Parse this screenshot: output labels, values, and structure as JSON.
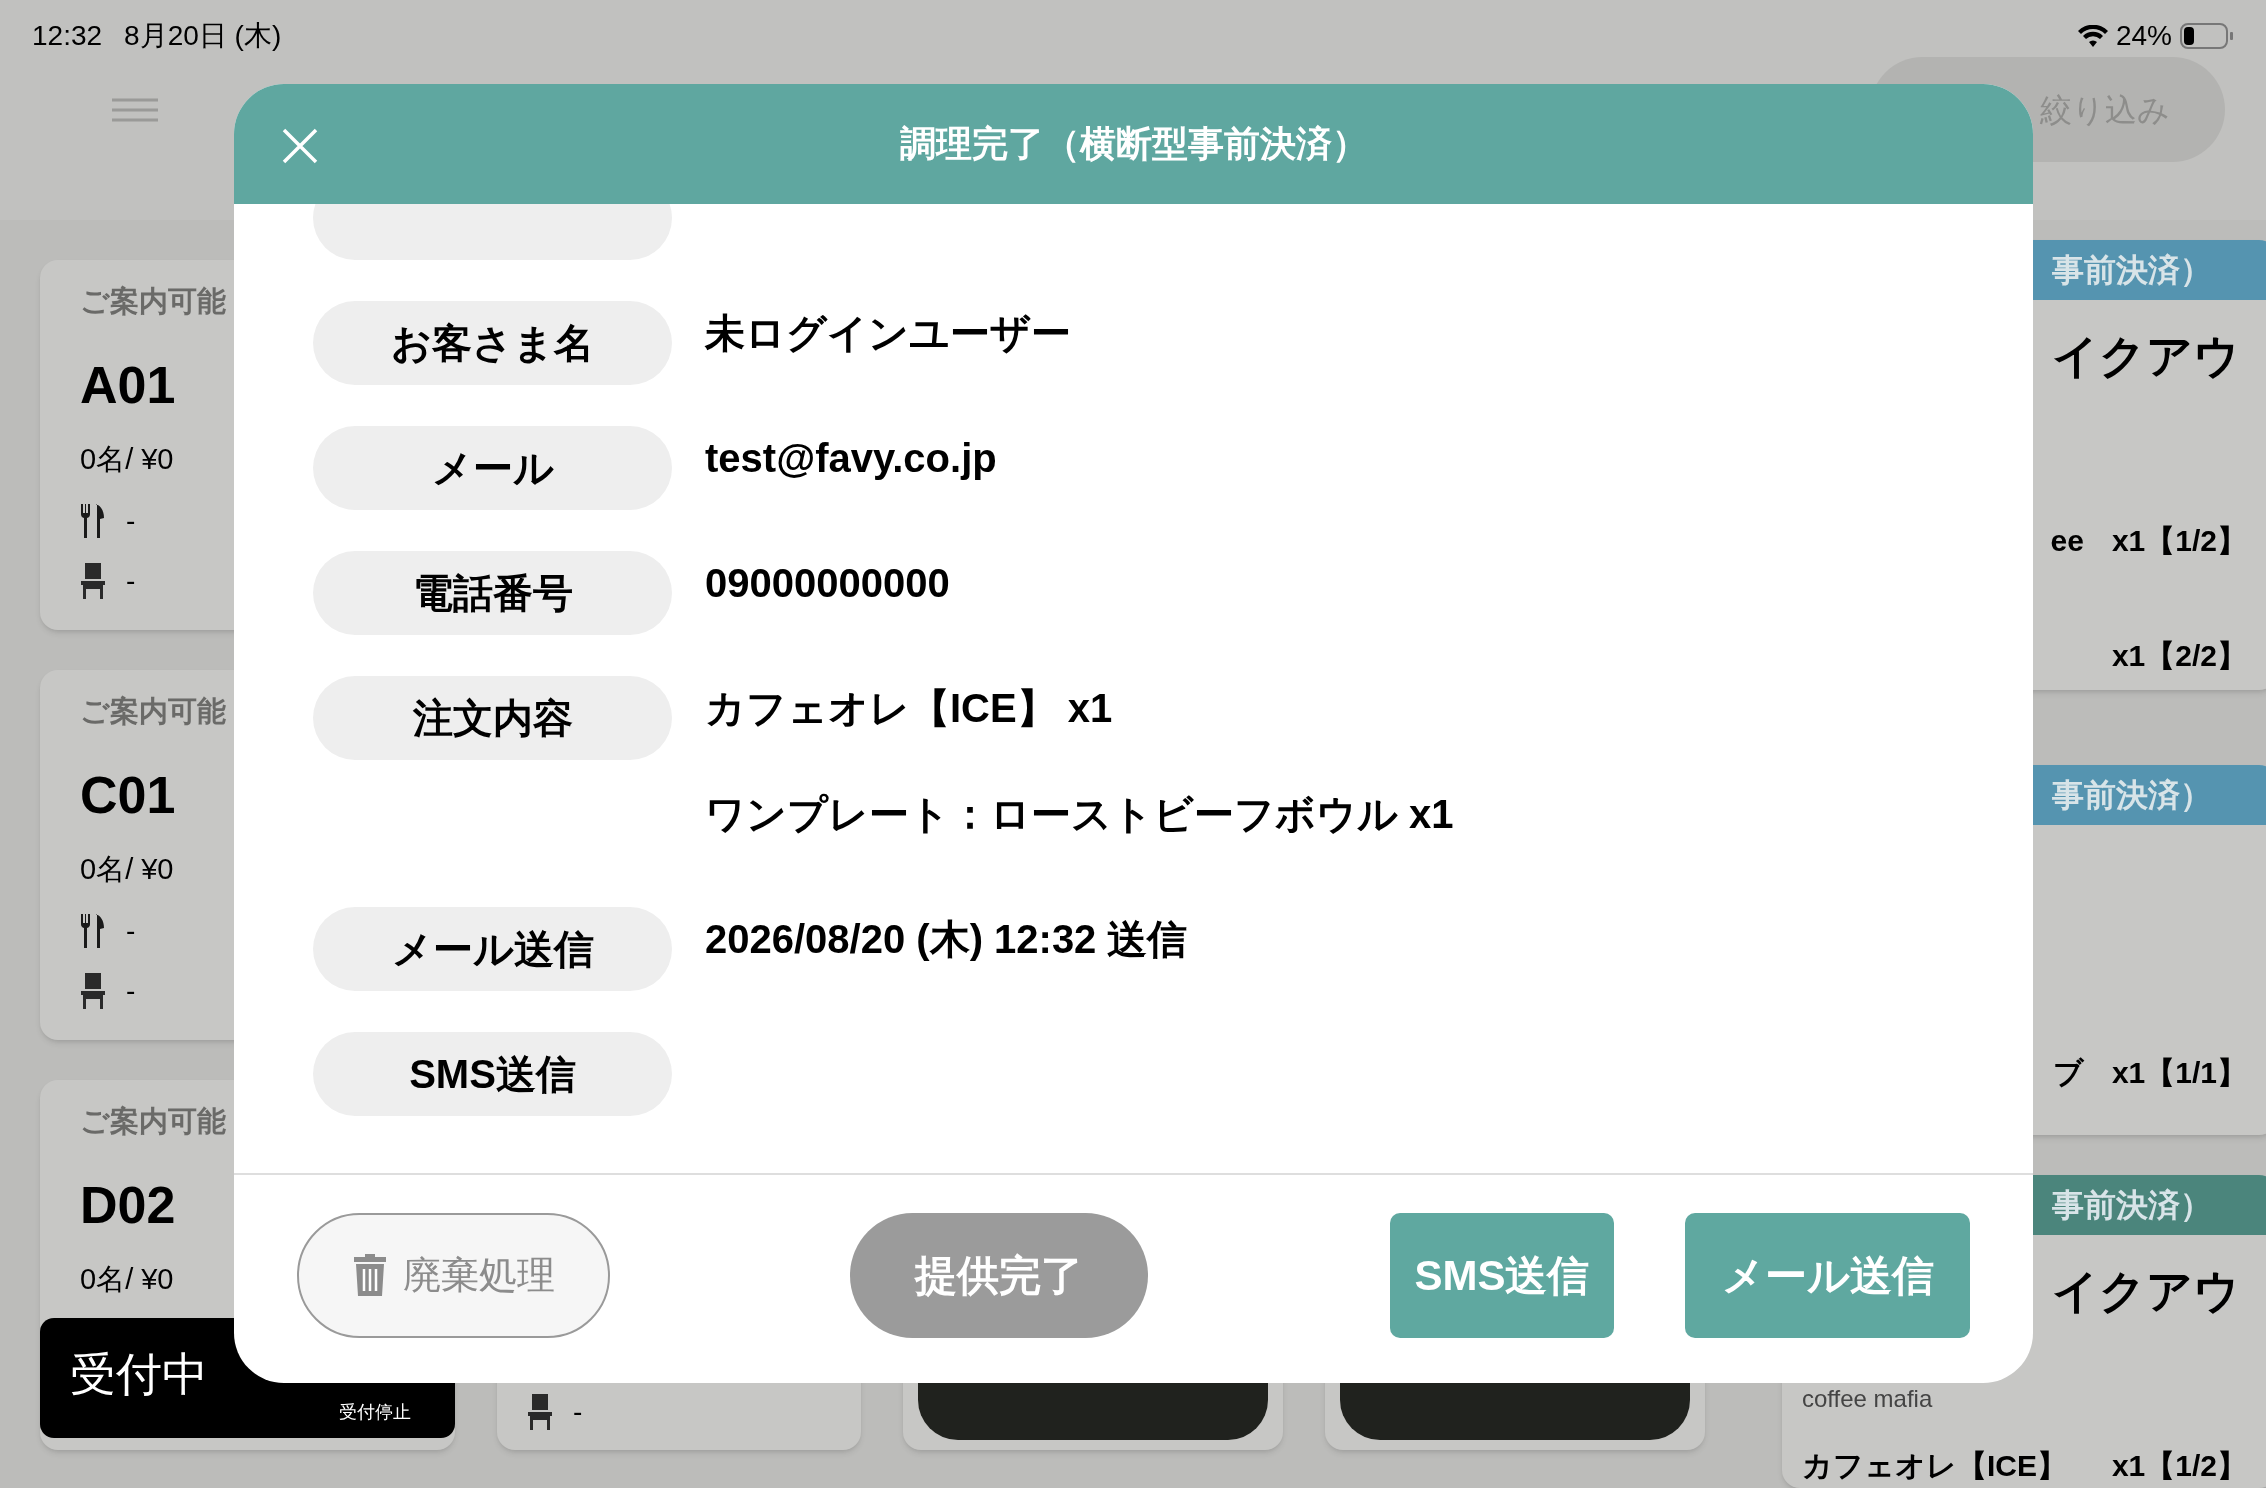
{
  "status_bar": {
    "time": "12:32",
    "date": "8月20日 (木)",
    "battery": "24%"
  },
  "filter_button": {
    "label": "絞り込み"
  },
  "left_cards": [
    {
      "status": "ご案内可能",
      "table": "A01",
      "summary": "0名/ ¥0",
      "dishes": "-",
      "seats": "-"
    },
    {
      "status": "ご案内可能",
      "table": "C01",
      "summary": "0名/ ¥0",
      "dishes": "-",
      "seats": "-"
    },
    {
      "status": "ご案内可能",
      "table": "D02",
      "summary": "0名/ ¥0"
    }
  ],
  "reception_toggle": {
    "label": "受付中",
    "sub_label": "受付停止"
  },
  "bottom_cards": [
    {
      "kind": "seat",
      "seats": "-"
    },
    {
      "kind": "dark"
    },
    {
      "kind": "dark"
    }
  ],
  "right_cards": [
    {
      "header": "事前決済）",
      "color": "#5594b0",
      "title": "イクアウ",
      "lines": [
        {
          "name": "ee",
          "qty": "x1【1/2】"
        },
        {
          "qty": "x1【2/2】"
        }
      ]
    },
    {
      "header": "事前決済）",
      "color": "#5594b0",
      "lines": [
        {
          "name": "ブ",
          "qty": "x1【1/1】"
        }
      ]
    },
    {
      "header": "事前決済）",
      "color": "#4b857c",
      "title": "イクアウ",
      "shop": "coffee mafia",
      "lines": [
        {
          "name": "カフェオレ【ICE】",
          "qty": "x1【1/2】"
        }
      ]
    }
  ],
  "modal": {
    "title": "調理完了（横断型事前決済）",
    "details": [
      {
        "label": "お客さま名",
        "values": [
          "未ログインユーザー"
        ]
      },
      {
        "label": "メール",
        "values": [
          "test@favy.co.jp"
        ]
      },
      {
        "label": "電話番号",
        "values": [
          "09000000000"
        ]
      },
      {
        "label": "注文内容",
        "values": [
          "カフェオレ【ICE】 x1",
          "ワンプレート：ローストビーフボウル x1"
        ]
      },
      {
        "label": "メール送信",
        "values": [
          "2026/08/20 (木) 12:32 送信"
        ]
      },
      {
        "label": "SMS送信"
      }
    ],
    "buttons": [
      {
        "kind": "discard",
        "label": "廃棄処理"
      },
      {
        "kind": "done",
        "label": "提供完了"
      },
      {
        "kind": "send",
        "label": "SMS送信"
      },
      {
        "kind": "send",
        "label": "メール送信"
      }
    ]
  }
}
